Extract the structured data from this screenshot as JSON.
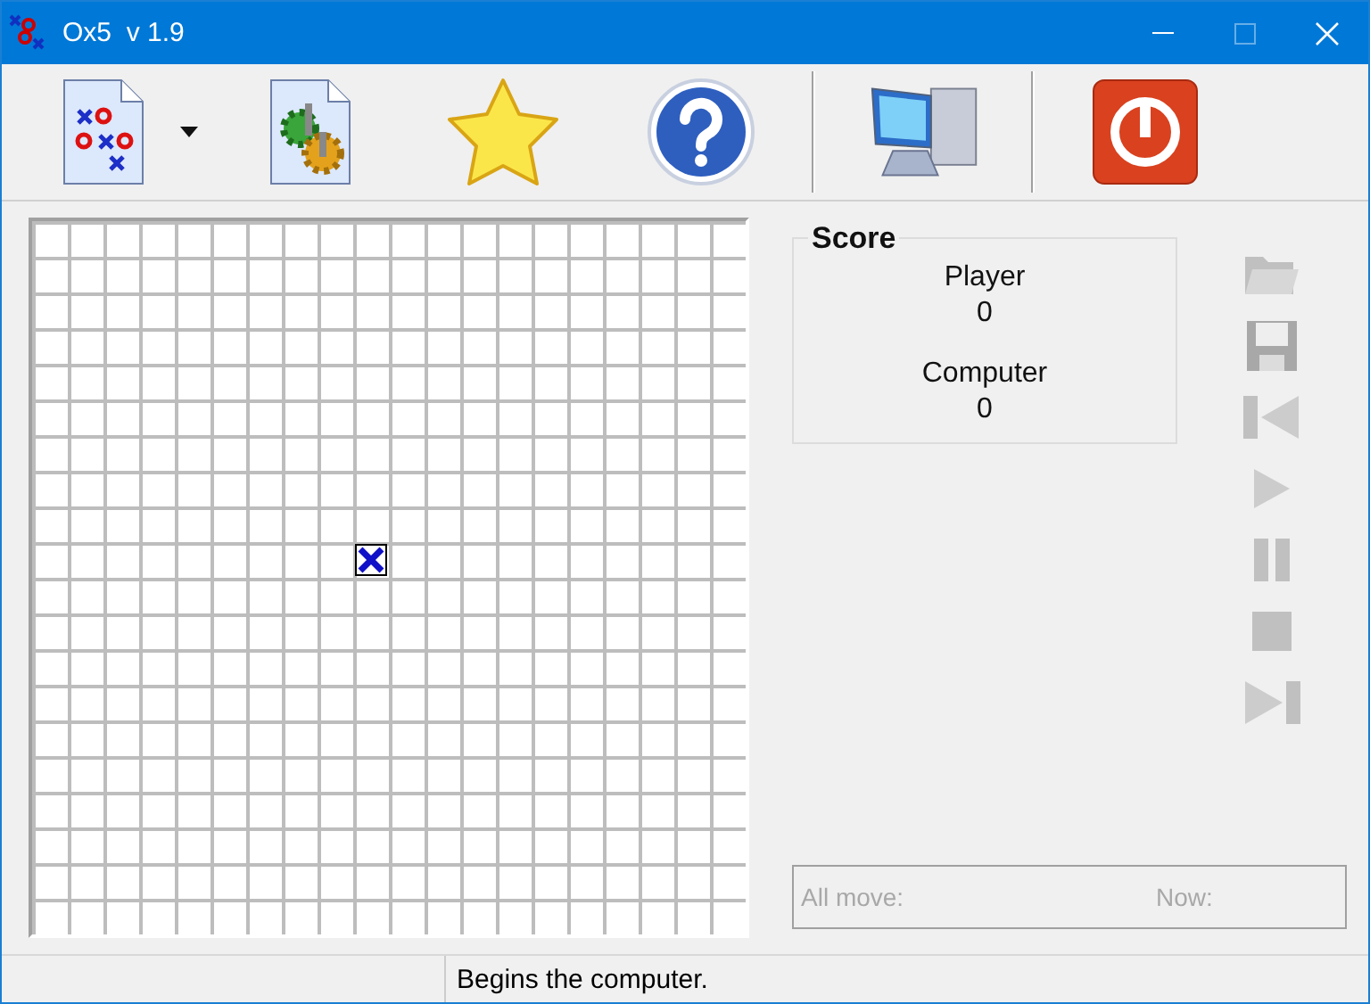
{
  "window": {
    "title": "Ox5  v 1.9"
  },
  "toolbar": [
    {
      "kind": "new"
    },
    {
      "kind": "dropdown"
    },
    {
      "kind": "settings"
    },
    {
      "kind": "star"
    },
    {
      "kind": "help"
    },
    {
      "kind": "separator"
    },
    {
      "kind": "computer"
    },
    {
      "kind": "separator"
    },
    {
      "kind": "power"
    }
  ],
  "board": {
    "marks": [
      {
        "kind": "x",
        "last_move": true
      }
    ]
  },
  "score": {
    "title": "Score",
    "entries": [
      {
        "label": "Player",
        "value": "0"
      },
      {
        "label": "Computer",
        "value": "0"
      }
    ]
  },
  "side_buttons": [
    {
      "kind": "open",
      "disabled": true
    },
    {
      "kind": "save",
      "disabled": true
    },
    {
      "kind": "first",
      "disabled": true
    },
    {
      "kind": "play",
      "disabled": true
    },
    {
      "kind": "pause",
      "disabled": true
    },
    {
      "kind": "stop",
      "disabled": true
    },
    {
      "kind": "last",
      "disabled": true
    }
  ],
  "moves": {
    "all_label": "All move:",
    "now_label": "Now:"
  },
  "status_bar": {
    "text": "Begins the computer."
  }
}
